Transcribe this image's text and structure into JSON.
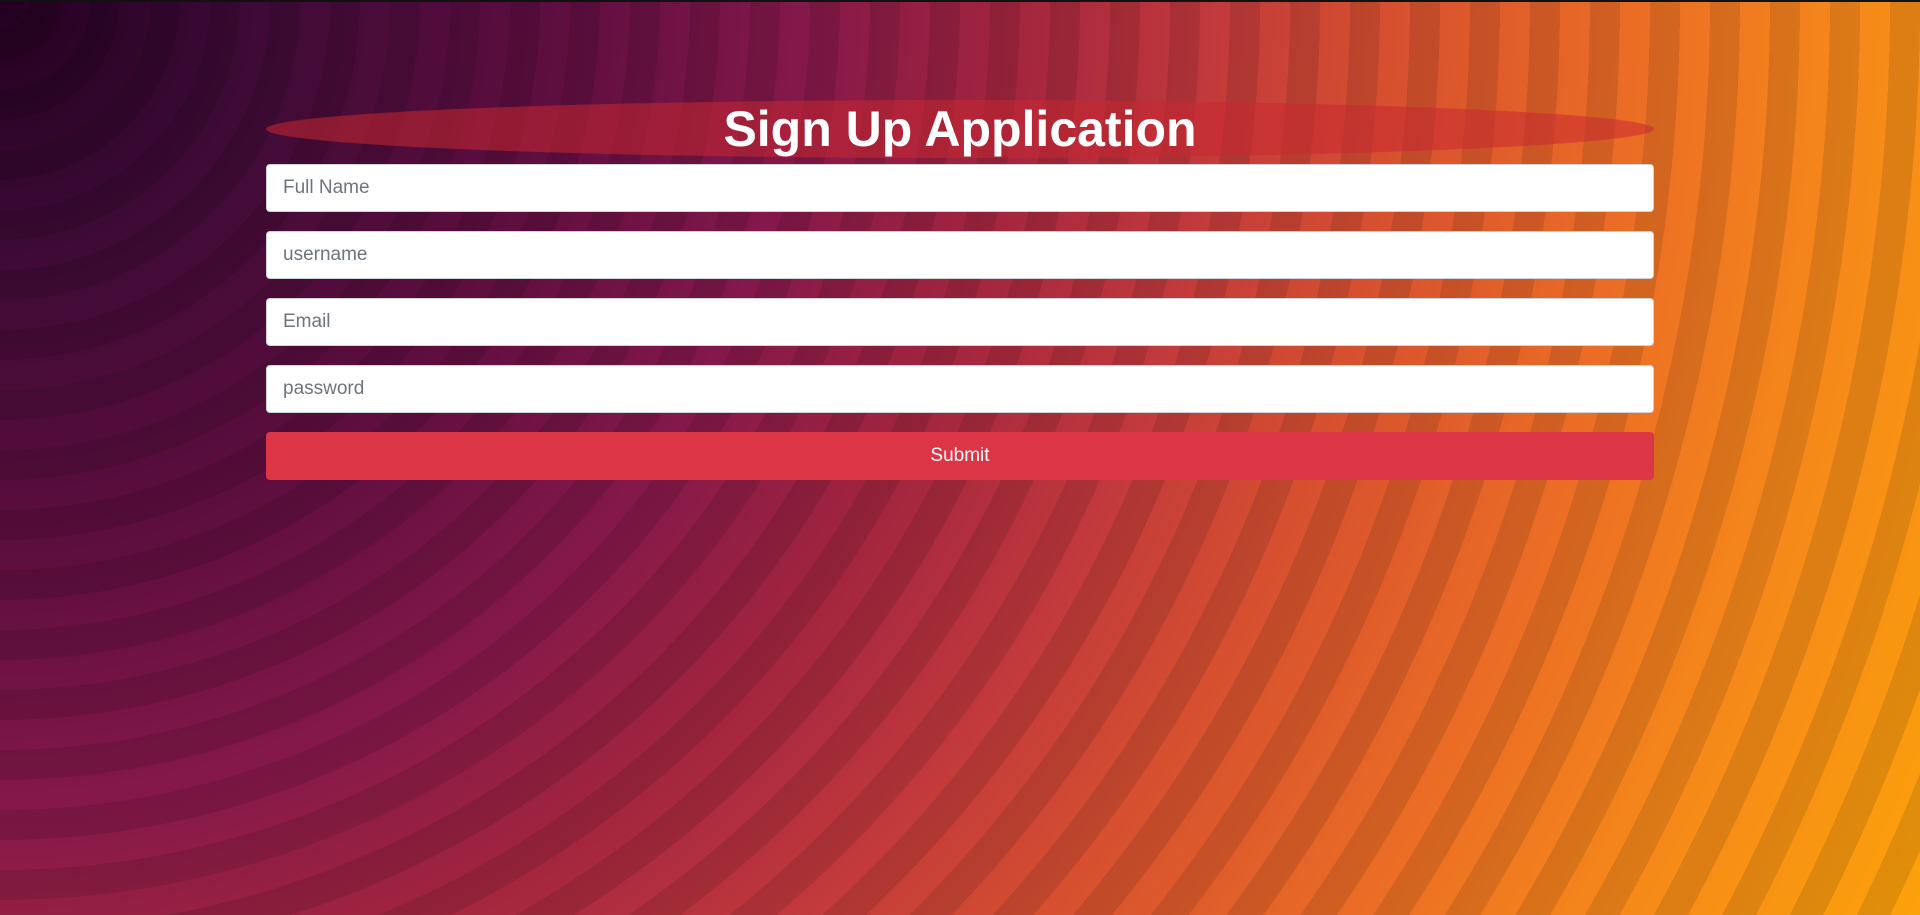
{
  "page": {
    "title": "Sign Up Application"
  },
  "form": {
    "full_name": {
      "placeholder": "Full Name",
      "value": ""
    },
    "username": {
      "placeholder": "username",
      "value": ""
    },
    "email": {
      "placeholder": "Email",
      "value": ""
    },
    "password": {
      "placeholder": "password",
      "value": ""
    },
    "submit_label": "Submit"
  },
  "colors": {
    "submit_button": "#dc3545",
    "title_text": "#ffffff",
    "input_background": "#ffffff"
  }
}
